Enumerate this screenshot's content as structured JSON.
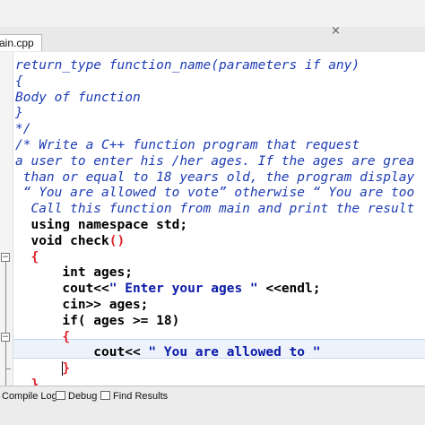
{
  "editor": {
    "tab_label": "ain.cpp",
    "tab_close_icon": "close-icon",
    "lines": [
      {
        "segments": [
          {
            "type": "comment",
            "text": "return_type function_name(parameters if any)"
          }
        ]
      },
      {
        "segments": [
          {
            "type": "comment",
            "text": "{"
          }
        ]
      },
      {
        "segments": [
          {
            "type": "comment",
            "text": "Body of function"
          }
        ]
      },
      {
        "segments": [
          {
            "type": "comment",
            "text": "}"
          }
        ]
      },
      {
        "segments": [
          {
            "type": "comment",
            "text": "*/"
          }
        ]
      },
      {
        "segments": [
          {
            "type": "comment",
            "text": "/* Write a C++ function program that request"
          }
        ]
      },
      {
        "segments": [
          {
            "type": "comment",
            "text": "a user to enter his /her ages. If the ages are grea"
          }
        ]
      },
      {
        "segments": [
          {
            "type": "comment",
            "text": " than or equal to 18 years old, the program display"
          }
        ]
      },
      {
        "segments": [
          {
            "type": "comment",
            "text": " “ You are allowed to vote” otherwise “ You are too"
          }
        ]
      },
      {
        "segments": [
          {
            "type": "comment",
            "text": "  Call this function from main and print the result"
          }
        ]
      },
      {
        "segments": [
          {
            "type": "plain",
            "text": "  using namespace std;"
          }
        ]
      },
      {
        "segments": [
          {
            "type": "plain",
            "text": "  void check"
          },
          {
            "type": "brace",
            "text": "()"
          }
        ]
      },
      {
        "segments": [
          {
            "type": "brace",
            "text": "  {"
          }
        ]
      },
      {
        "segments": [
          {
            "type": "plain",
            "text": "      int ages;"
          }
        ]
      },
      {
        "segments": [
          {
            "type": "plain",
            "text": "      cout<<"
          },
          {
            "type": "str",
            "text": "\" Enter your ages \""
          },
          {
            "type": "plain",
            "text": " <<endl;"
          }
        ]
      },
      {
        "segments": [
          {
            "type": "plain",
            "text": "      cin>> ages;"
          }
        ]
      },
      {
        "segments": [
          {
            "type": "plain",
            "text": "      if( ages >= 18)"
          }
        ]
      },
      {
        "segments": [
          {
            "type": "brace",
            "text": "      {"
          }
        ]
      },
      {
        "segments": [
          {
            "type": "plain",
            "text": "          cout<< "
          },
          {
            "type": "str",
            "text": "\" You are allowed to \""
          }
        ]
      },
      {
        "segments": [
          {
            "type": "brace",
            "text": "      }"
          }
        ]
      },
      {
        "segments": [
          {
            "type": "brace",
            "text": "  }"
          }
        ]
      }
    ],
    "caret_line": 19
  },
  "bottom_panel": {
    "tabs": [
      {
        "label": "Compile Log",
        "icon": "compile-log-icon"
      },
      {
        "label": "Debug",
        "icon": "debug-icon"
      },
      {
        "label": "Find Results",
        "icon": "find-results-icon"
      }
    ]
  },
  "colors": {
    "comment": "#1e3cb4",
    "string": "#0a1aa8",
    "brace": "#e0242c",
    "keyword": "#000000",
    "current_line": "#eef3fb"
  }
}
